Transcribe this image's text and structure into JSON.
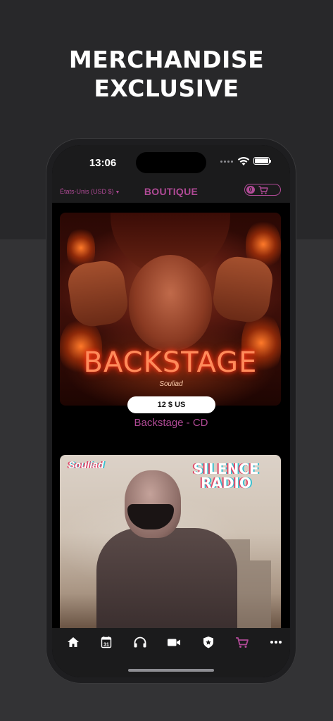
{
  "headline": {
    "line1": "MERCHANDISE",
    "line2": "EXCLUSIVE"
  },
  "status_bar": {
    "time": "13:06"
  },
  "header": {
    "currency": "États-Unis (USD $)",
    "title": "BOUTIQUE",
    "cart_count": "0"
  },
  "products": [
    {
      "cover_text": "BACKSTAGE",
      "signature": "Souliad",
      "price": "12 $ US",
      "name": "Backstage - CD"
    },
    {
      "cover_title": "SILENCE RADIO",
      "signature": "Souliad"
    }
  ],
  "tab_bar": {
    "items": [
      "home-icon",
      "calendar-icon",
      "headphones-icon",
      "video-icon",
      "badge-icon",
      "cart-icon",
      "more-icon"
    ],
    "calendar_day": "31",
    "active_color": "#b04a96",
    "inactive_color": "#ffffff"
  },
  "colors": {
    "accent": "#b04a96",
    "background": "#000000",
    "bar": "#1b1b1c"
  }
}
